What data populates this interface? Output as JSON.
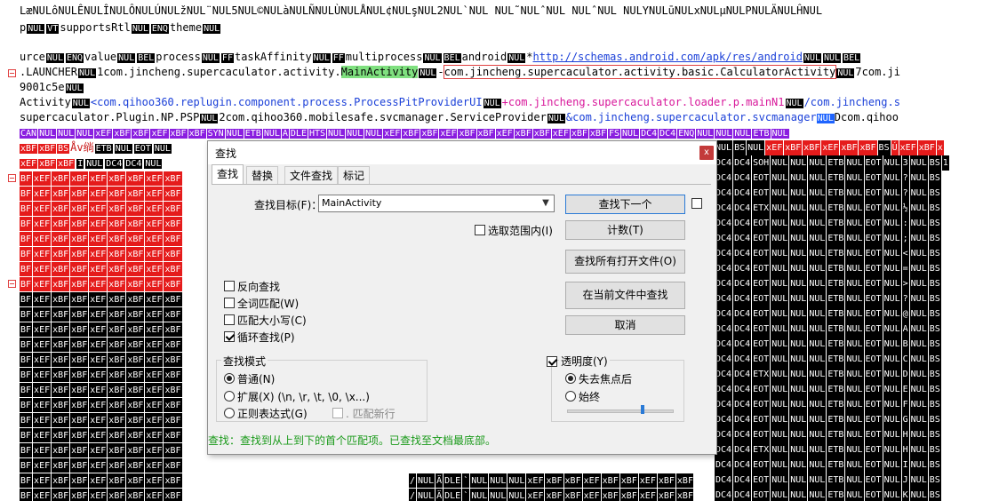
{
  "editor": {
    "line_top1": "LæNULôNULÊNULÎNULÔNULÚNULžNUL¨NUL5NUL©NULàNULÑNULÙNULÅNUL¢NULşNUL2NUL`NUL NUL˜NULˆNUL NULˆNUL NULYNULūNULxNULµNULPNULÄNULĤNUL",
    "line_top2_a": "p",
    "line_top2_ctrl1": "NUL",
    "line_top2_ctrl2": "VT",
    "line_top2_b": "supportsRtl",
    "line_top2_ctrl3": "NUL",
    "line_top2_ctrl4": "ENQ",
    "line_top2_c": "theme",
    "line_top2_ctrl5": "NUL",
    "line3_a": "urce",
    "line3_c1": "NUL",
    "line3_c2": "ENQ",
    "line3_b": "value",
    "line3_c3": "NUL",
    "line3_c4": "BEL",
    "line3_c": "process",
    "line3_c5": "NUL",
    "line3_c6": "FF",
    "line3_d": "taskAffinity",
    "line3_c7": "NUL",
    "line3_c8": "FF",
    "line3_e": "multiprocess",
    "line3_c9": "NUL",
    "line3_c10": "BEL",
    "line3_f": "android",
    "line3_c11": "NUL",
    "line3_g": "*",
    "line3_url": "http://schemas.android.com/apk/res/android",
    "line3_c12": "NUL",
    "line3_c13": "NUL",
    "line3_c14": "BEL",
    "line4_a": ".LAUNCHER",
    "line4_c1": "NUL",
    "line4_b": "1com.jincheng.supercaculator.activity.",
    "line4_match": "MainActivity",
    "line4_c2": "NUL",
    "line4_dash": "-",
    "line4_box": "com.jincheng.supercaculator.activity.basic.CalculatorActivity",
    "line4_c3": "NUL",
    "line4_c": "7com.ji",
    "line5": "9001c5e",
    "line5_c1": "NUL",
    "line6_a": "Activity",
    "line6_c1": "NUL",
    "line6_b": "<com.qihoo360.replugin.component.process.ProcessPitProviderUI",
    "line6_c2": "NUL",
    "line6_c": "+com.jincheng.supercaculator.loader.p.mainN1",
    "line6_c3": "NUL",
    "line6_d": "/com.jincheng.s",
    "line7_a": "supercaculator.Plugin.NP.PSP",
    "line7_c1": "NUL",
    "line7_b": "2com.qihoo360.mobilesafe.svcmanager.ServiceProvider",
    "line7_c2": "NUL",
    "line7_c": "&com.jincheng.supercaculator.svcmanager",
    "line7_sel": "NUL",
    "line7_d": "Dcom.qihoo",
    "line8_tokens": [
      "CAN",
      "NUL",
      "NUL",
      "NUL",
      "xEF",
      "xBF",
      "xBF",
      "xEF",
      "xBF",
      "xBF",
      "SYN",
      "NUL",
      "ETB",
      "NUL",
      "Ä",
      "DLE",
      "HTS",
      "NUL",
      "NUL",
      "NUL",
      "xEF",
      "xBF",
      "xBF",
      "xEF",
      "xBF",
      "xBF",
      "xEF",
      "xBF",
      "xBF",
      "xEF",
      "xBF",
      "xBF",
      "FS",
      "NUL",
      "DC4",
      "DC4",
      "ENQ",
      "NUL",
      "NUL",
      "NUL",
      "ETB",
      "NUL"
    ],
    "line9_a": [
      "xBF",
      "xBF",
      "BS"
    ],
    "line9_glyph": "Åv绱",
    "line9_b": [
      "ETB",
      "NUL",
      "EOT",
      "NUL"
    ],
    "line9_right": [
      "NUL",
      "BS",
      "NUL",
      "xEF",
      "xBF",
      "xBF",
      "xEF",
      "xBF",
      "xBF",
      "BS",
      "Ú",
      "xEF",
      "xBF",
      "x"
    ],
    "line10_a": [
      "xEF",
      "xBF",
      "xBF",
      "I",
      "NUL",
      "DC4",
      "DC4",
      "NUL"
    ],
    "line10_right": [
      "DC4",
      "DC4",
      "SOH",
      "NUL",
      "NUL",
      "NUL",
      "ETB",
      "NUL",
      "EOT",
      "NUL",
      "3",
      "NUL",
      "BS",
      "1"
    ],
    "red_row": [
      "BF",
      "xEF",
      "xBF",
      "xBF",
      "xEF",
      "xBF",
      "xBF",
      "xEF",
      "xBF"
    ],
    "black_row": [
      "BF",
      "xEF",
      "xBF",
      "xBF",
      "xEF",
      "xBF",
      "xBF",
      "xEF",
      "xBF"
    ],
    "right_rows": [
      [
        "DC4",
        "DC4",
        "EOT",
        "NUL",
        "NUL",
        "NUL",
        "ETB",
        "NUL",
        "EOT",
        "NUL",
        "?",
        "NUL",
        "BS"
      ],
      [
        "DC4",
        "DC4",
        "EOT",
        "NUL",
        "NUL",
        "NUL",
        "ETB",
        "NUL",
        "EOT",
        "NUL",
        "?",
        "NUL",
        "BS"
      ],
      [
        "DC4",
        "DC4",
        "ETX",
        "NUL",
        "NUL",
        "NUL",
        "ETB",
        "NUL",
        "EOT",
        "NUL",
        "½",
        "NUL",
        "BS"
      ],
      [
        "DC4",
        "DC4",
        "EOT",
        "NUL",
        "NUL",
        "NUL",
        "ETB",
        "NUL",
        "EOT",
        "NUL",
        ":",
        "NUL",
        "BS"
      ],
      [
        "DC4",
        "DC4",
        "EOT",
        "NUL",
        "NUL",
        "NUL",
        "ETB",
        "NUL",
        "EOT",
        "NUL",
        ";",
        "NUL",
        "BS"
      ],
      [
        "DC4",
        "DC4",
        "EOT",
        "NUL",
        "NUL",
        "NUL",
        "ETB",
        "NUL",
        "EOT",
        "NUL",
        "<",
        "NUL",
        "BS"
      ],
      [
        "DC4",
        "DC4",
        "EOT",
        "NUL",
        "NUL",
        "NUL",
        "ETB",
        "NUL",
        "EOT",
        "NUL",
        "=",
        "NUL",
        "BS"
      ],
      [
        "DC4",
        "DC4",
        "EOT",
        "NUL",
        "NUL",
        "NUL",
        "ETB",
        "NUL",
        "EOT",
        "NUL",
        ">",
        "NUL",
        "BS"
      ],
      [
        "DC4",
        "DC4",
        "EOT",
        "NUL",
        "NUL",
        "NUL",
        "ETB",
        "NUL",
        "EOT",
        "NUL",
        "?",
        "NUL",
        "BS"
      ],
      [
        "DC4",
        "DC4",
        "EOT",
        "NUL",
        "NUL",
        "NUL",
        "ETB",
        "NUL",
        "EOT",
        "NUL",
        "@",
        "NUL",
        "BS"
      ],
      [
        "DC4",
        "DC4",
        "EOT",
        "NUL",
        "NUL",
        "NUL",
        "ETB",
        "NUL",
        "EOT",
        "NUL",
        "A",
        "NUL",
        "BS"
      ],
      [
        "DC4",
        "DC4",
        "EOT",
        "NUL",
        "NUL",
        "NUL",
        "ETB",
        "NUL",
        "EOT",
        "NUL",
        "B",
        "NUL",
        "BS"
      ],
      [
        "DC4",
        "DC4",
        "EOT",
        "NUL",
        "NUL",
        "NUL",
        "ETB",
        "NUL",
        "EOT",
        "NUL",
        "C",
        "NUL",
        "BS"
      ],
      [
        "DC4",
        "DC4",
        "ETX",
        "NUL",
        "NUL",
        "NUL",
        "ETB",
        "NUL",
        "EOT",
        "NUL",
        "D",
        "NUL",
        "BS"
      ],
      [
        "DC4",
        "DC4",
        "EOT",
        "NUL",
        "NUL",
        "NUL",
        "ETB",
        "NUL",
        "EOT",
        "NUL",
        "E",
        "NUL",
        "BS"
      ],
      [
        "DC4",
        "DC4",
        "EOT",
        "NUL",
        "NUL",
        "NUL",
        "ETB",
        "NUL",
        "EOT",
        "NUL",
        "F",
        "NUL",
        "BS"
      ],
      [
        "DC4",
        "DC4",
        "EOT",
        "NUL",
        "NUL",
        "NUL",
        "ETB",
        "NUL",
        "EOT",
        "NUL",
        "G",
        "NUL",
        "BS"
      ],
      [
        "DC4",
        "DC4",
        "EOT",
        "NUL",
        "NUL",
        "NUL",
        "ETB",
        "NUL",
        "EOT",
        "NUL",
        "H",
        "NUL",
        "BS"
      ],
      [
        "DC4",
        "DC4",
        "ETX",
        "NUL",
        "NUL",
        "NUL",
        "ETB",
        "NUL",
        "EOT",
        "NUL",
        "H",
        "NUL",
        "BS"
      ],
      [
        "DC4",
        "DC4",
        "EOT",
        "NUL",
        "NUL",
        "NUL",
        "ETB",
        "NUL",
        "EOT",
        "NUL",
        "I",
        "NUL",
        "BS"
      ],
      [
        "DC4",
        "DC4",
        "EOT",
        "NUL",
        "NUL",
        "NUL",
        "ETB",
        "NUL",
        "EOT",
        "NUL",
        "J",
        "NUL",
        "BS"
      ],
      [
        "DC4",
        "DC4",
        "EOT",
        "NUL",
        "NUL",
        "NUL",
        "ETB",
        "NUL",
        "EOT",
        "NUL",
        "K",
        "NUL",
        "BS"
      ],
      [
        "DC4",
        "DC4",
        "ETX",
        "NUL",
        "NUL",
        "NUL",
        "ETB",
        "NUL",
        "EOT",
        "NUL",
        "L",
        "NUL",
        "BS"
      ]
    ],
    "bottom_row1": [
      "BF",
      "xEF",
      "xBF",
      "xBF",
      "xEF",
      "xBF",
      "xBF",
      "xEF",
      "xBF",
      "xBF",
      "/",
      "NUL",
      "Ä",
      "DLE",
      "`",
      "NUL",
      "NUL",
      "NUL",
      "xEF",
      "xBF",
      "xBF",
      "xEF",
      "xBF",
      "xBF",
      "xEF",
      "xBF",
      "xBF",
      "xEF",
      "xBF",
      "xBF",
      "/",
      "NUL"
    ],
    "bottom_row2": [
      "BF",
      "xEF",
      "xBF",
      "xBF",
      "xEF",
      "xBF",
      "xBF",
      "xEF",
      "xBF",
      "xBF",
      "/",
      "NUL",
      "Ä",
      "DLE",
      "`",
      "NUL",
      "NUL",
      "NUL",
      "xEF",
      "xBF",
      "xBF",
      "xEF",
      "xBF",
      "xBF",
      "xEF",
      "xBF",
      "xBF",
      "xEF",
      "xBF",
      "xBF",
      "/",
      "NUL"
    ],
    "bottom_row3": [
      "BF",
      "xEF",
      "xBF",
      "xBF",
      "xEF",
      "xBF",
      "xBF",
      "xEF",
      "xBF",
      "xBF",
      "/",
      "NUL",
      "Ä",
      "DLE",
      "`",
      "NUL",
      "NUL",
      "NUL",
      "xEF",
      "xBF",
      "xBF",
      "xEF",
      "xBF",
      "xBF",
      "xEF",
      "xBF",
      "xBF",
      "xEF",
      "xBF",
      "xBF",
      "/",
      "NUL"
    ]
  },
  "dialog": {
    "title": "查找",
    "close_label": "x",
    "tabs": [
      {
        "label": "查找"
      },
      {
        "label": "替换"
      },
      {
        "label": "文件查找"
      },
      {
        "label": "标记"
      }
    ],
    "find_target_label": "查找目标(F)：",
    "find_value": "MainActivity",
    "in_selection_label": "选取范围内(I)",
    "buttons": {
      "find_next": "查找下一个",
      "count": "计数(T)",
      "find_all_open": "查找所有打开文件(O)",
      "find_in_current": "在当前文件中查找",
      "cancel": "取消"
    },
    "options": {
      "reverse": "反向查找",
      "whole_word": "全词匹配(W)",
      "match_case": "匹配大小写(C)",
      "wrap": "循环查找(P)"
    },
    "search_mode": {
      "title": "查找模式",
      "normal": "普通(N)",
      "extended": "扩展(X) (\\n, \\r, \\t, \\0, \\x...)",
      "regex": "正则表达式(G)",
      "dot_newline": ". 匹配新行"
    },
    "transparency": {
      "title": "透明度(Y)",
      "on_lose_focus": "失去焦点后",
      "always": "始终",
      "slider_value": 0.72
    },
    "status": "查找：查找到从上到下的首个匹配项。已查找至文档最底部。"
  }
}
